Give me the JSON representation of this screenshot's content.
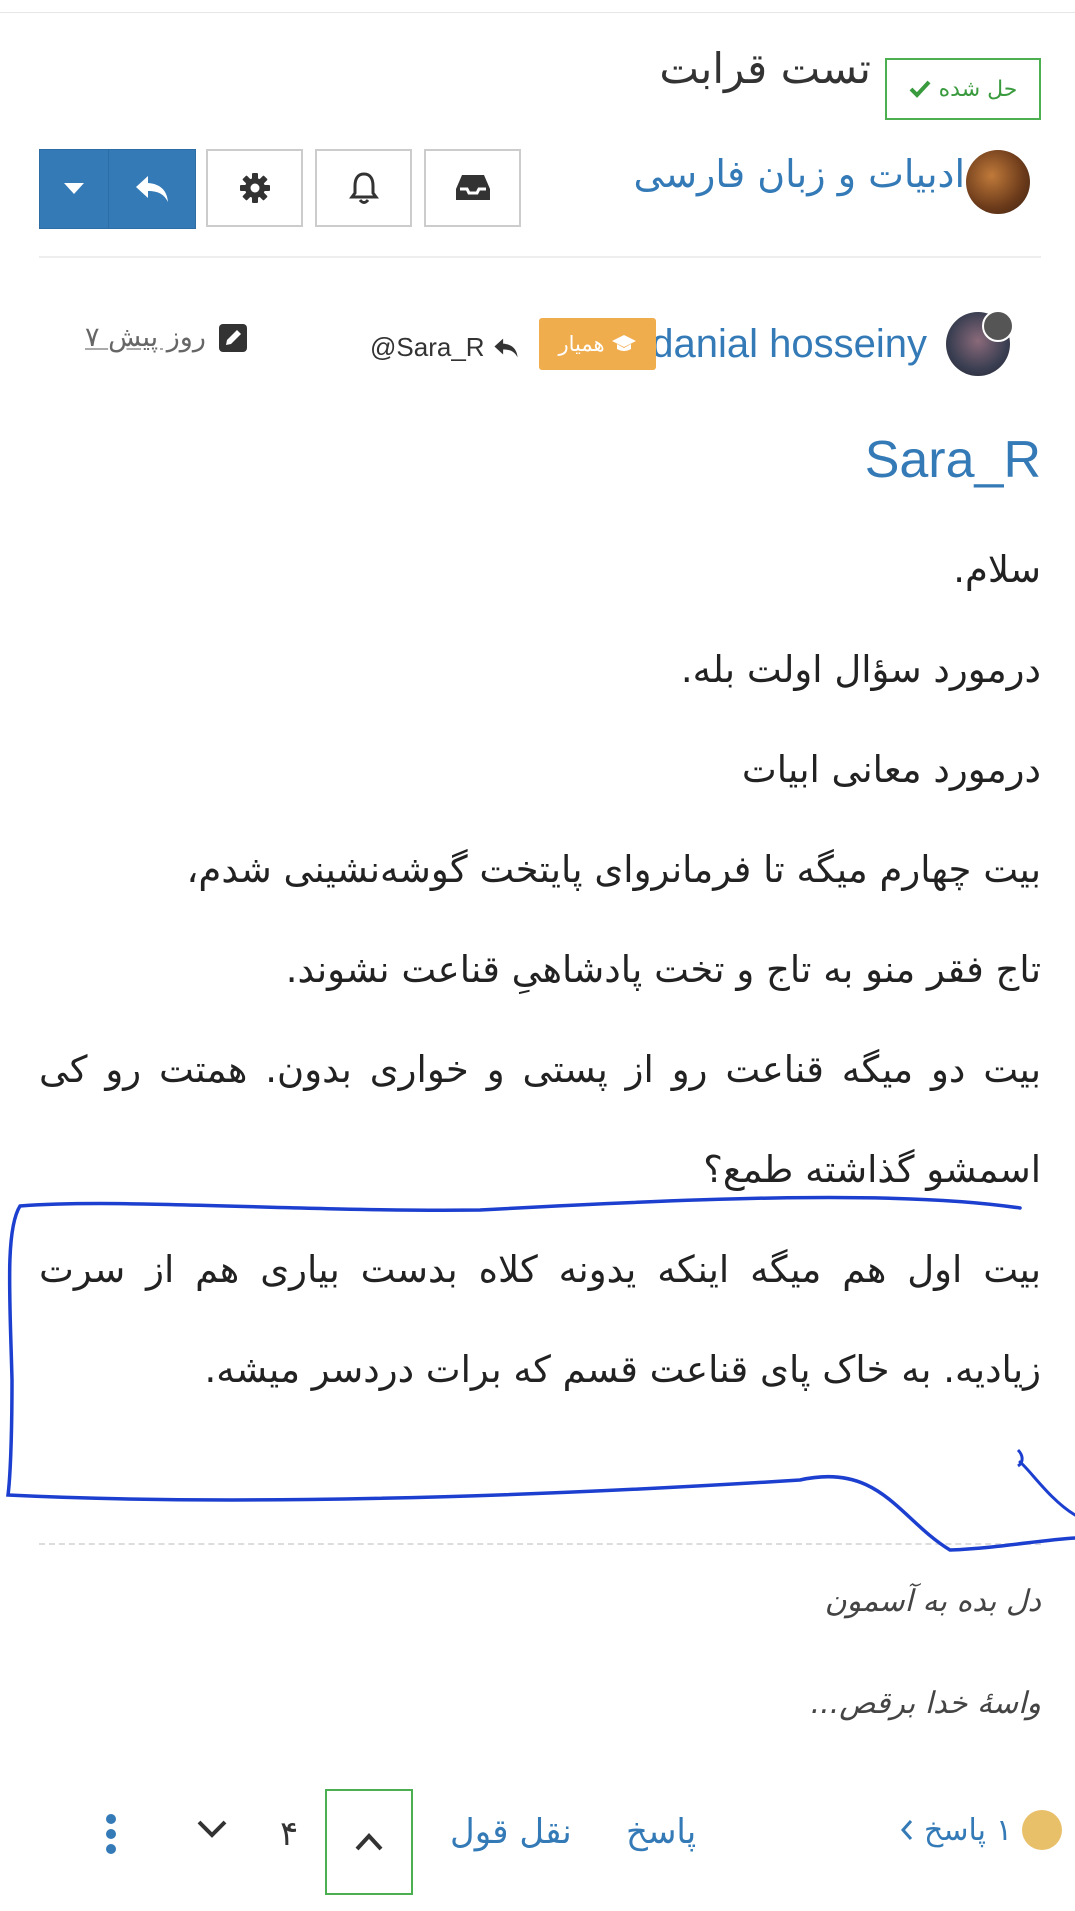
{
  "header": {
    "solved_label": "حل شده",
    "title": "تست قرابت",
    "category": "ادبیات و زبان فارسی"
  },
  "post": {
    "username": "danial hosseiny",
    "badge": "همیار",
    "reply_to": "@Sara_R",
    "edited": "۷ روز پیش",
    "mention": "Sara_R",
    "paragraphs": [
      "سلام.",
      "درمورد سؤال اولت بله.",
      "درمورد معانی ابیات",
      "بیت چهارم میگه تا فرمانروای پایتخت گوشه‌نشینی شدم،",
      "تاج فقر منو به تاج و تخت پادشاهیِ قناعت نشوند.",
      "بیت دو میگه قناعت رو از پستی و خواری بدون. همتت رو کی اسمشو گذاشته طمع؟",
      "بیت اول هم میگه اینکه یدونه کلاه بدست بیاری هم از سرت زیادیه. به خاک پای قناعت قسم که برات دردسر میشه."
    ],
    "signature_line1": "دل بده به آسمون",
    "signature_line2": "واسهٔ خدا برقص..."
  },
  "footer": {
    "replies_count": "۱",
    "replies_label": "پاسخ",
    "reply_label": "پاسخ",
    "quote_label": "نقل قول",
    "votes": "۴"
  },
  "colors": {
    "link": "#337ab7",
    "solved": "#4caf50",
    "badge": "#f0ad4e",
    "annotation": "#1c3fd0"
  },
  "icons": [
    "check-icon",
    "inbox-icon",
    "bell-icon",
    "gear-icon",
    "reply-icon",
    "caret-down-icon",
    "graduation-cap-icon",
    "reply-arrow-icon",
    "pencil-icon",
    "chevron-up-icon",
    "chevron-down-icon",
    "chevron-left-icon",
    "ellipsis-vertical-icon"
  ]
}
